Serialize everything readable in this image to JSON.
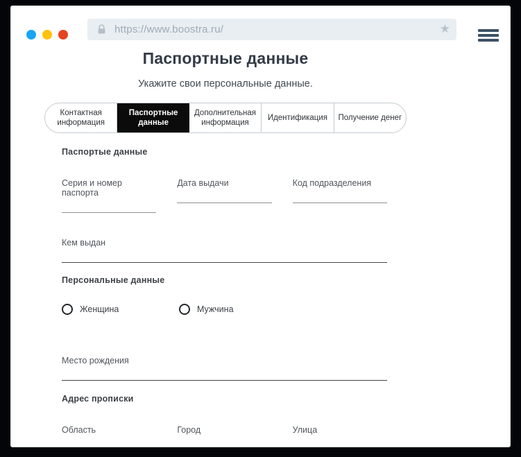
{
  "browser": {
    "url": "https://www.boostra.ru/",
    "traffic_light_colors": [
      "#18a5f3",
      "#ffc20e",
      "#e8431f"
    ],
    "icons": [
      "lock-icon",
      "star-icon",
      "hamburger-menu-icon"
    ]
  },
  "page": {
    "title": "Паспортные данные",
    "subtitle": "Укажите свои персональные данные.",
    "tabs": [
      {
        "label": "Контактная информация",
        "active": false
      },
      {
        "label": "Паспортные данные",
        "active": true
      },
      {
        "label": "Дополнительная информация",
        "active": false
      },
      {
        "label": "Идентификация",
        "active": false
      },
      {
        "label": "Получение денег",
        "active": false
      }
    ],
    "form": {
      "passport_section": {
        "title": "Паспортые данные",
        "fields": {
          "series_number": {
            "label": "Серия и номер паспорта",
            "value": ""
          },
          "issue_date": {
            "label": "Дата выдачи",
            "value": ""
          },
          "division_code": {
            "label": "Код подразделения",
            "value": ""
          },
          "issued_by": {
            "label": "Кем выдан",
            "value": ""
          }
        }
      },
      "personal_section": {
        "title": "Персональные данные",
        "gender_options": [
          {
            "label": "Женщина",
            "selected": false
          },
          {
            "label": "Мужчина",
            "selected": false
          }
        ],
        "birthplace": {
          "label": "Место рождения",
          "value": ""
        }
      },
      "address_section": {
        "title": "Адрес прописки",
        "fields": {
          "region": {
            "label": "Область",
            "value": ""
          },
          "city": {
            "label": "Город",
            "value": ""
          },
          "street": {
            "label": "Улица",
            "value": ""
          }
        }
      }
    }
  },
  "colors": {
    "frame": "#040508",
    "active_tab_bg": "#0b0b0b",
    "title_text": "#333b47",
    "urlbar_bg": "#e9eef2",
    "urlbar_text": "#9fabb6",
    "hamburger": "#3c5164"
  }
}
